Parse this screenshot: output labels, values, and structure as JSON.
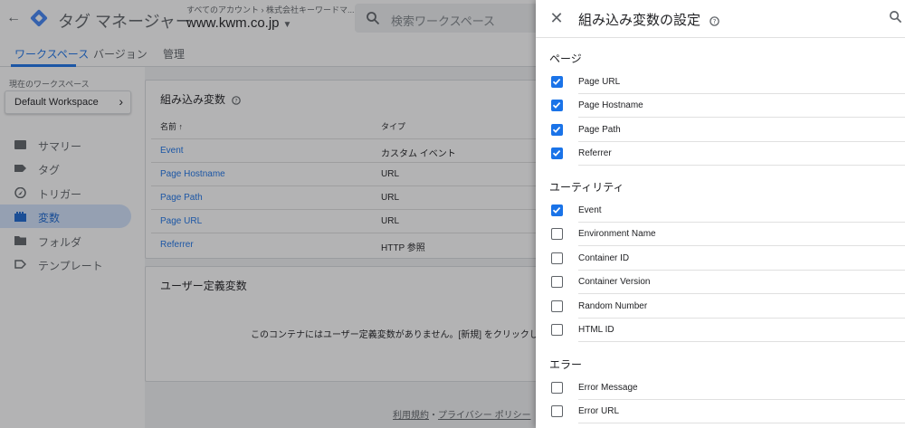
{
  "app": {
    "back_label": "←",
    "title": "タグ マネージャー",
    "breadcrumb": "すべてのアカウント › 株式会社キーワードマ...",
    "container": "www.kwm.co.jp",
    "search_placeholder": "検索ワークスペース"
  },
  "nav_tabs": [
    {
      "label": "ワークスペース",
      "active": true
    },
    {
      "label": "バージョン",
      "active": false
    },
    {
      "label": "管理",
      "active": false
    }
  ],
  "workspace": {
    "label": "現在のワークスペース",
    "name": "Default Workspace"
  },
  "sidenav": [
    {
      "label": "サマリー",
      "icon": "summary-icon",
      "active": false
    },
    {
      "label": "タグ",
      "icon": "tag-icon",
      "active": false
    },
    {
      "label": "トリガー",
      "icon": "trigger-icon",
      "active": false
    },
    {
      "label": "変数",
      "icon": "variables-icon",
      "active": true
    },
    {
      "label": "フォルダ",
      "icon": "folder-icon",
      "active": false
    },
    {
      "label": "テンプレート",
      "icon": "template-icon",
      "active": false
    }
  ],
  "builtin_card": {
    "title": "組み込み変数",
    "col_name": "名前 ↑",
    "col_type": "タイプ",
    "rows": [
      {
        "name": "Event",
        "type": "カスタム イベント"
      },
      {
        "name": "Page Hostname",
        "type": "URL"
      },
      {
        "name": "Page Path",
        "type": "URL"
      },
      {
        "name": "Page URL",
        "type": "URL"
      },
      {
        "name": "Referrer",
        "type": "HTTP 参照"
      }
    ]
  },
  "user_card": {
    "title": "ユーザー定義変数",
    "empty_message": "このコンテナにはユーザー定義変数がありません。[新規] をクリックし"
  },
  "footer": {
    "terms": "利用規約",
    "separator": "・",
    "privacy": "プライバシー ポリシー"
  },
  "drawer": {
    "title": "組み込み変数の設定",
    "sections": [
      {
        "label": "ページ",
        "items": [
          {
            "name": "Page URL",
            "checked": true
          },
          {
            "name": "Page Hostname",
            "checked": true
          },
          {
            "name": "Page Path",
            "checked": true
          },
          {
            "name": "Referrer",
            "checked": true
          }
        ]
      },
      {
        "label": "ユーティリティ",
        "items": [
          {
            "name": "Event",
            "checked": true
          },
          {
            "name": "Environment Name",
            "checked": false
          },
          {
            "name": "Container ID",
            "checked": false
          },
          {
            "name": "Container Version",
            "checked": false
          },
          {
            "name": "Random Number",
            "checked": false
          },
          {
            "name": "HTML ID",
            "checked": false
          }
        ]
      },
      {
        "label": "エラー",
        "items": [
          {
            "name": "Error Message",
            "checked": false
          },
          {
            "name": "Error URL",
            "checked": false
          }
        ]
      }
    ]
  },
  "colors": {
    "accent": "#1a73e8",
    "active_nav_bg": "#d2e3fc",
    "scrim": "rgba(32,33,36,0.34)"
  }
}
